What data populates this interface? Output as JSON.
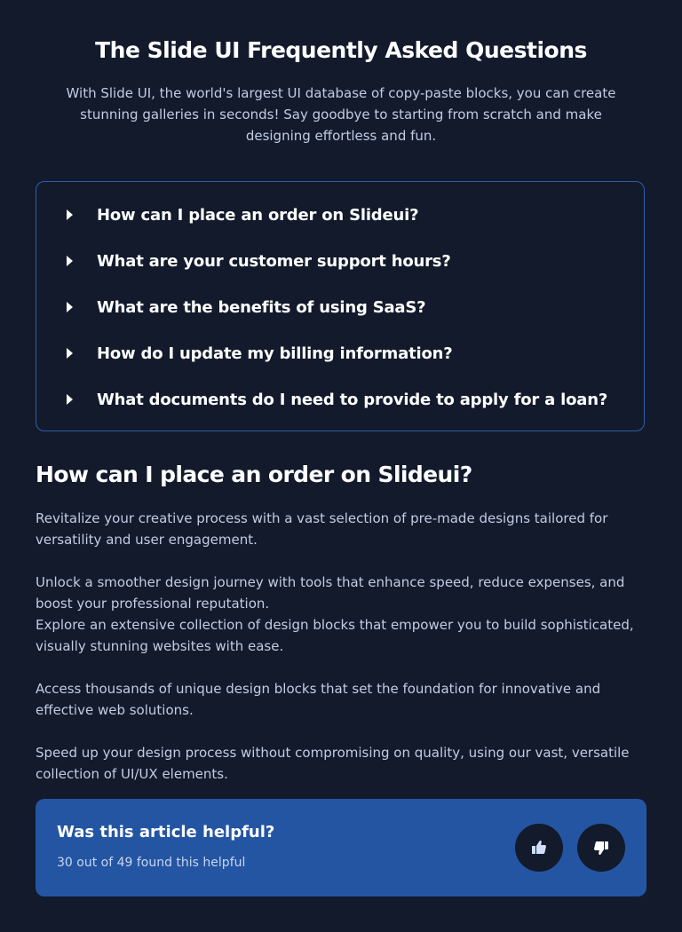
{
  "header": {
    "title": "The Slide UI Frequently Asked Questions",
    "intro": "With Slide UI, the world's largest UI database of copy-paste blocks, you can create stunning galleries in seconds! Say goodbye to starting from scratch and make designing effortless and fun."
  },
  "faq": {
    "items": [
      {
        "label": "How can I place an order on Slideui?",
        "icon": "caret-right-icon"
      },
      {
        "label": "What are your customer support hours?",
        "icon": "caret-right-icon"
      },
      {
        "label": "What are the benefits of using SaaS?",
        "icon": "caret-right-icon"
      },
      {
        "label": "How do I update my billing information?",
        "icon": "caret-right-icon"
      },
      {
        "label": "What documents do I need to provide to apply for a loan?",
        "icon": "caret-right-icon"
      }
    ]
  },
  "answer": {
    "title": "How can I place an order on Slideui?",
    "paragraphs": [
      "Revitalize your creative process with a vast selection of pre-made designs tailored for versatility and user engagement.",
      "Unlock a smoother design journey with tools that enhance speed, reduce expenses, and boost your professional reputation.",
      "Explore an extensive collection of design blocks that empower you to build sophisticated, visually stunning websites with ease.",
      "Access thousands of unique design blocks that set the foundation for innovative and effective web solutions.",
      "Speed up your design process without compromising on quality, using our vast, versatile collection of UI/UX elements."
    ]
  },
  "feedback": {
    "question": "Was this article helpful?",
    "count_text": "30 out of 49 found this helpful",
    "helpful_count": 30,
    "total_count": 49,
    "thumbs_up_icon": "thumbs-up-icon",
    "thumbs_down_icon": "thumbs-down-icon"
  },
  "colors": {
    "background": "#121a2c",
    "accent": "#2455a3",
    "border": "#2f5dab",
    "muted_text": "#c2cde3"
  }
}
